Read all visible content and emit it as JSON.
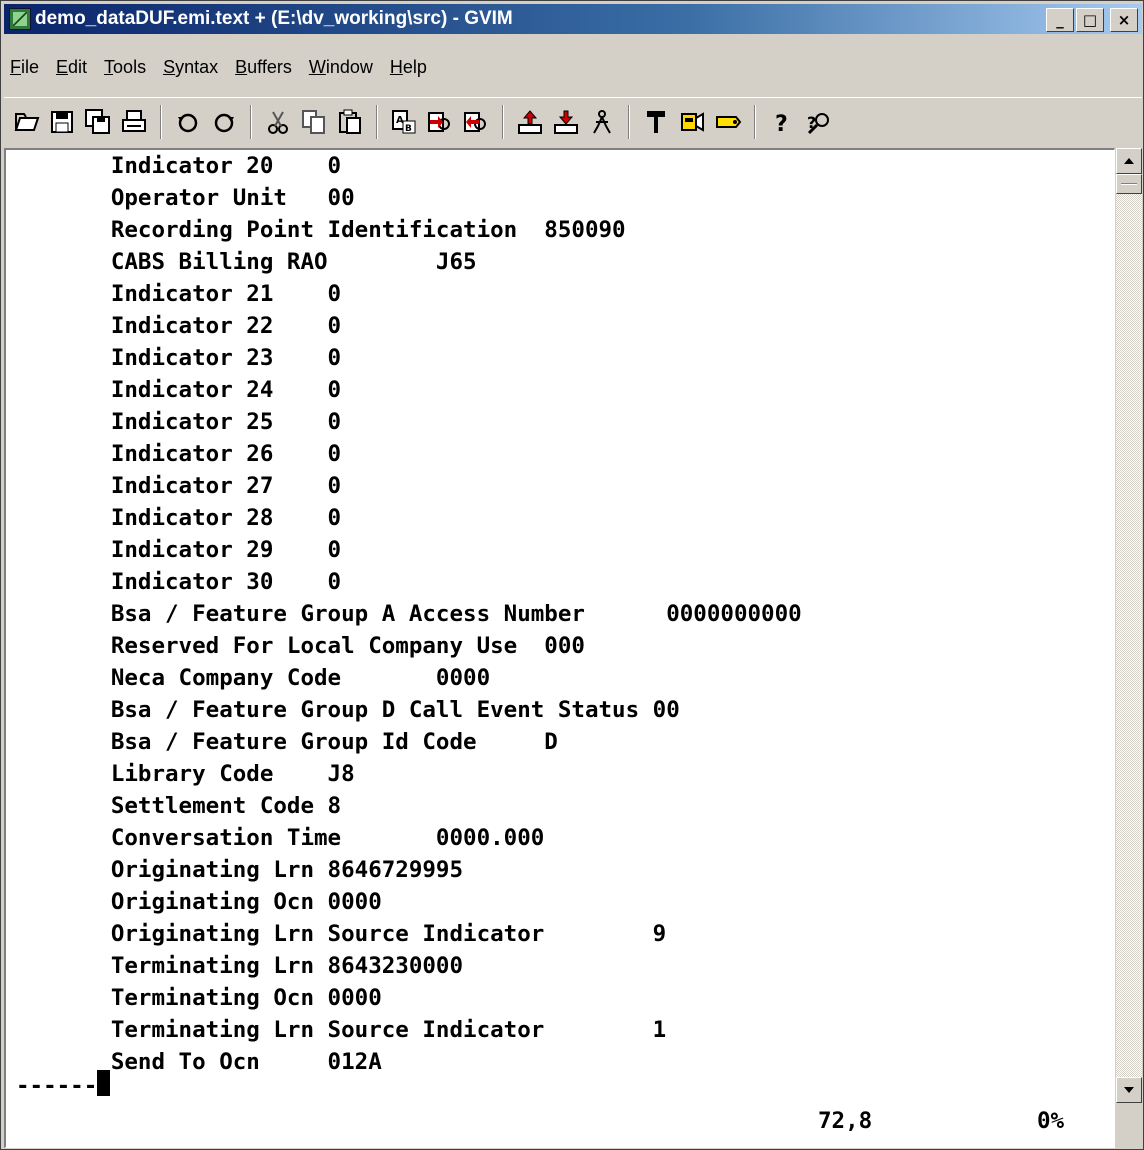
{
  "window": {
    "title": "demo_dataDUF.emi.text + (E:\\dv_working\\src) - GVIM",
    "icon": "vim-icon",
    "controls": {
      "minimize": "_",
      "maximize": "□",
      "close": "×"
    }
  },
  "menu": [
    {
      "pre": "",
      "ul": "F",
      "post": "ile"
    },
    {
      "pre": "",
      "ul": "E",
      "post": "dit"
    },
    {
      "pre": "",
      "ul": "T",
      "post": "ools"
    },
    {
      "pre": "",
      "ul": "S",
      "post": "yntax"
    },
    {
      "pre": "",
      "ul": "B",
      "post": "uffers"
    },
    {
      "pre": "",
      "ul": "W",
      "post": "indow"
    },
    {
      "pre": "",
      "ul": "H",
      "post": "elp"
    }
  ],
  "toolbar": {
    "groups": [
      [
        "open-icon",
        "save-icon",
        "save-all-icon",
        "print-icon"
      ],
      [
        "undo-icon",
        "redo-icon"
      ],
      [
        "cut-icon",
        "copy-icon",
        "paste-icon"
      ],
      [
        "replace-icon",
        "find-next-icon",
        "find-prev-icon"
      ],
      [
        "load-session-icon",
        "save-session-icon",
        "run-script-icon"
      ],
      [
        "make-icon",
        "shell-icon",
        "tag-jump-icon"
      ],
      [
        "help-icon",
        "find-help-icon"
      ]
    ]
  },
  "editor": {
    "lines": [
      "       Indicator 20    0",
      "       Operator Unit   00",
      "       Recording Point Identification  850090",
      "       CABS Billing RAO        J65",
      "       Indicator 21    0",
      "       Indicator 22    0",
      "       Indicator 23    0",
      "       Indicator 24    0",
      "       Indicator 25    0",
      "       Indicator 26    0",
      "       Indicator 27    0",
      "       Indicator 28    0",
      "       Indicator 29    0",
      "       Indicator 30    0",
      "       Bsa / Feature Group A Access Number      0000000000",
      "       Reserved For Local Company Use  000",
      "       Neca Company Code       0000",
      "       Bsa / Feature Group D Call Event Status 00",
      "       Bsa / Feature Group Id Code     D",
      "       Library Code    J8",
      "       Settlement Code 8",
      "       Conversation Time       0000.000",
      "       Originating Lrn 8646729995",
      "       Originating Ocn 0000",
      "       Originating Lrn Source Indicator        9",
      "       Terminating Lrn 8643230000",
      "       Terminating Ocn 0000",
      "       Terminating Lrn Source Indicator        1",
      "       Send To Ocn     012A"
    ],
    "cursor_line": "------",
    "ruler_position": "72,8",
    "ruler_percent": "0%"
  }
}
